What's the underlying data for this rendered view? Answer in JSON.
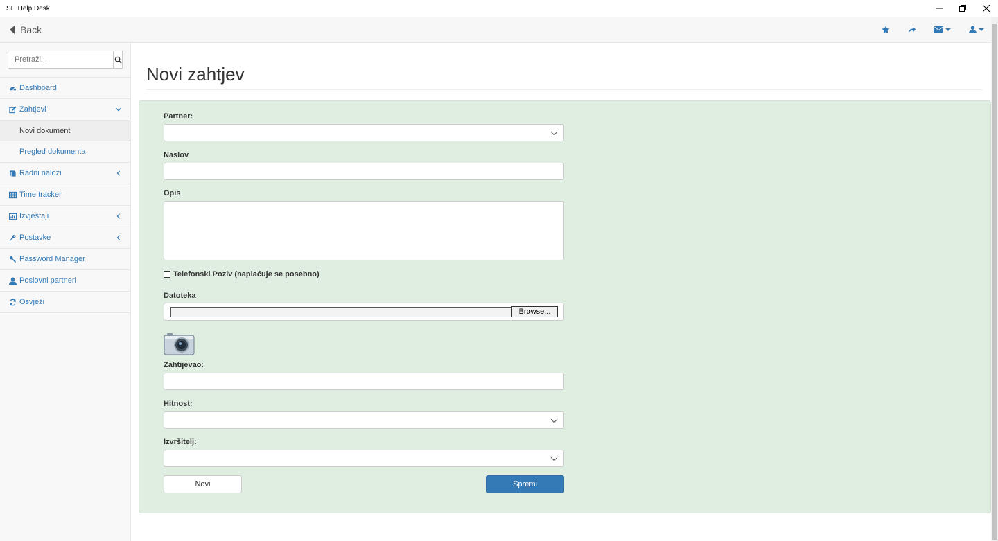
{
  "window": {
    "title": "SH Help Desk"
  },
  "topnav": {
    "back_label": "Back",
    "icons": [
      "star-icon",
      "share-icon",
      "envelope-icon",
      "user-icon"
    ]
  },
  "sidebar": {
    "search_placeholder": "Pretraži...",
    "items": [
      {
        "label": "Dashboard",
        "icon": "dashboard-icon"
      },
      {
        "label": "Zahtjevi",
        "icon": "edit-icon",
        "expanded": true,
        "children": [
          {
            "label": "Novi dokument",
            "active": true
          },
          {
            "label": "Pregled dokumenta"
          }
        ]
      },
      {
        "label": "Radni nalozi",
        "icon": "book-icon"
      },
      {
        "label": "Time tracker",
        "icon": "table-icon"
      },
      {
        "label": "Izvještaji",
        "icon": "chart-icon"
      },
      {
        "label": "Postavke",
        "icon": "wrench-icon"
      },
      {
        "label": "Password Manager",
        "icon": "key-icon"
      },
      {
        "label": "Poslovni partneri",
        "icon": "user-icon"
      },
      {
        "label": "Osvježi",
        "icon": "refresh-icon"
      }
    ]
  },
  "page": {
    "title": "Novi zahtjev"
  },
  "form": {
    "partner_label": "Partner:",
    "naslov_label": "Naslov",
    "opis_label": "Opis",
    "phone_call_label": "Telefonski Poziv (naplaćuje se posebno)",
    "datoteka_label": "Datoteka",
    "browse_label": "Browse...",
    "zahtijevao_label": "Zahtijevao:",
    "hitnost_label": "Hitnost:",
    "izvrsitelj_label": "Izvršitelj:",
    "novi_button": "Novi",
    "spremi_button": "Spremi"
  },
  "colors": {
    "accent": "#337ab7",
    "panel_bg": "#dfeee1"
  }
}
